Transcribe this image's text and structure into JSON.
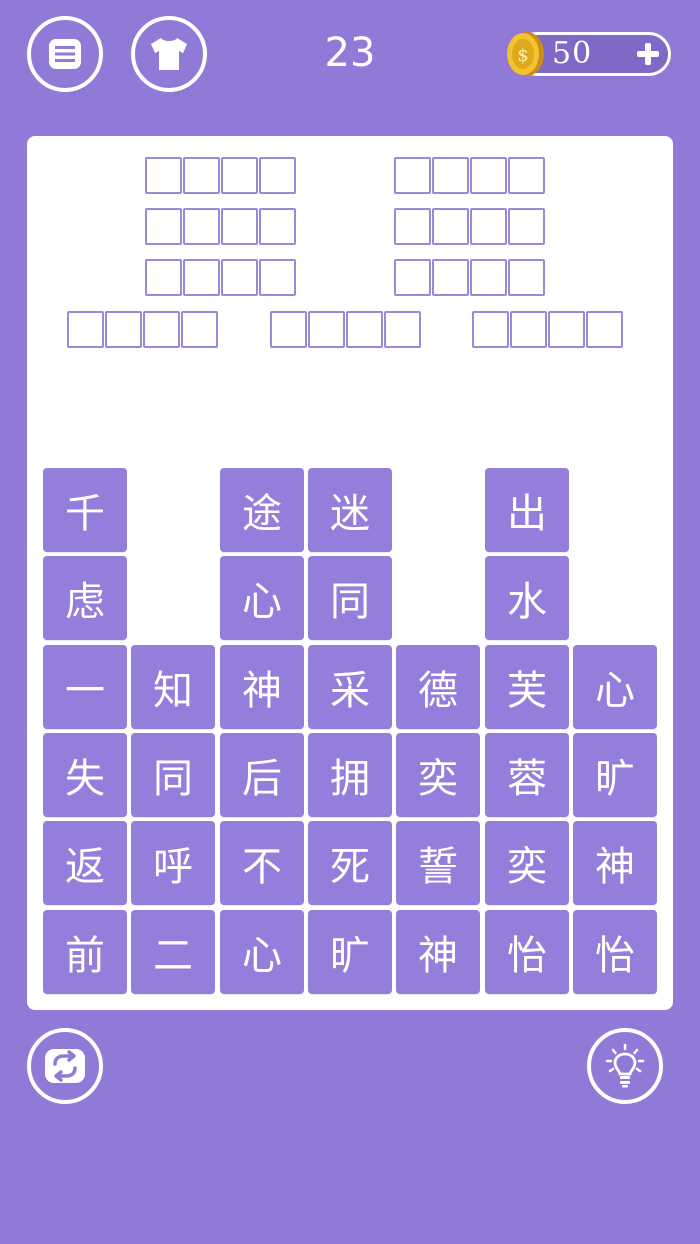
{
  "header": {
    "level": "23",
    "coins": "50"
  },
  "answer_slots": {
    "rows": [
      {
        "groups": 2,
        "slots_per_group": 4
      },
      {
        "groups": 2,
        "slots_per_group": 4
      },
      {
        "groups": 2,
        "slots_per_group": 4
      },
      {
        "groups": 3,
        "slots_per_group": 4
      }
    ]
  },
  "tiles": {
    "rows": [
      [
        "千",
        "",
        "途",
        "迷",
        "",
        "出",
        ""
      ],
      [
        "虑",
        "",
        "心",
        "同",
        "",
        "水",
        ""
      ],
      [
        "一",
        "知",
        "神",
        "采",
        "德",
        "芙",
        "心"
      ],
      [
        "失",
        "同",
        "后",
        "拥",
        "奕",
        "蓉",
        "旷"
      ],
      [
        "返",
        "呼",
        "不",
        "死",
        "誓",
        "奕",
        "神"
      ],
      [
        "前",
        "二",
        "心",
        "旷",
        "神",
        "怡",
        "怡"
      ]
    ]
  },
  "colors": {
    "background": "#9179d8",
    "tile": "#957ddb",
    "board": "#ffffff",
    "coin": "#e8b420"
  },
  "icons": {
    "menu": "menu-icon",
    "skin": "shirt-icon",
    "coin": "coin-icon",
    "add": "plus-icon",
    "refresh": "refresh-icon",
    "hint": "lightbulb-icon"
  }
}
